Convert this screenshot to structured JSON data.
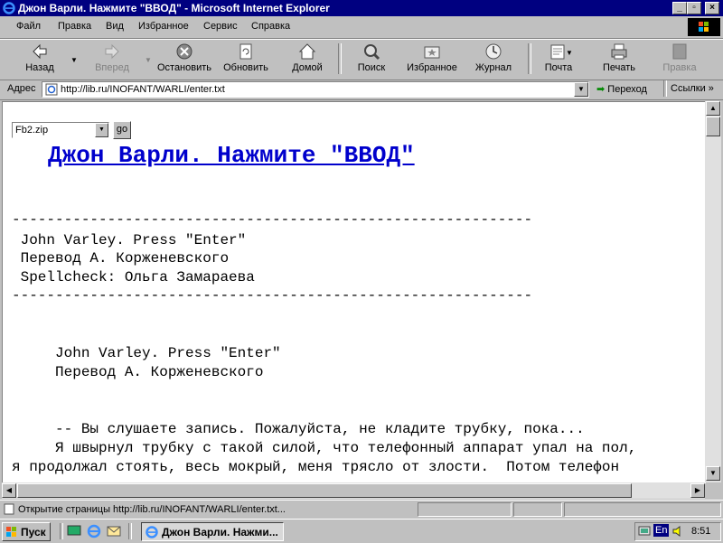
{
  "window": {
    "title": "Джон Варли. Нажмите \"ВВОД\" - Microsoft Internet Explorer",
    "controls": {
      "minimize": "_",
      "maximize": "▫",
      "close": "×"
    }
  },
  "menu": {
    "items": [
      {
        "label": "Файл"
      },
      {
        "label": "Правка"
      },
      {
        "label": "Вид"
      },
      {
        "label": "Избранное"
      },
      {
        "label": "Сервис"
      },
      {
        "label": "Справка"
      }
    ]
  },
  "toolbar": {
    "back": "Назад",
    "forward": "Вперед",
    "stop": "Остановить",
    "refresh": "Обновить",
    "home": "Домой",
    "search": "Поиск",
    "favorites": "Избранное",
    "history": "Журнал",
    "mail": "Почта",
    "print": "Печать",
    "edit": "Правка"
  },
  "address_bar": {
    "label": "Адрес",
    "url": "http://lib.ru/INOFANT/WARLI/enter.txt",
    "go": "Переход",
    "links": "Ссылки"
  },
  "content": {
    "format_select": "Fb2.zip",
    "go_button": "go",
    "heading": "Джон Варли. Нажмите \"ВВОД\"",
    "separator": "------------------------------------------------------------",
    "header_lines": [
      " John Varley. Press \"Enter\"",
      " Перевод А. Корженевского",
      " Spellcheck: Ольга Замараева"
    ],
    "body_lines": [
      "     John Varley. Press \"Enter\"",
      "     Перевод А. Корженевского",
      "",
      "",
      "",
      "     -- Вы слушаете запись. Пожалуйста, не кладите трубку, пока...",
      "     Я швырнул трубку с такой силой, что телефонный аппарат упал на пол,",
      "я продолжал стоять, весь мокрый, меня трясло от злости.  Потом телефон"
    ]
  },
  "status_bar": {
    "text": "Открытие страницы http://lib.ru/INOFANT/WARLI/enter.txt..."
  },
  "taskbar": {
    "start": "Пуск",
    "task_ie": "Джон Варли. Нажми...",
    "lang": "En",
    "clock": "8:51"
  },
  "colors": {
    "titlebar": "#000080",
    "link": "#0000cc",
    "chrome": "#c0c0c0"
  }
}
